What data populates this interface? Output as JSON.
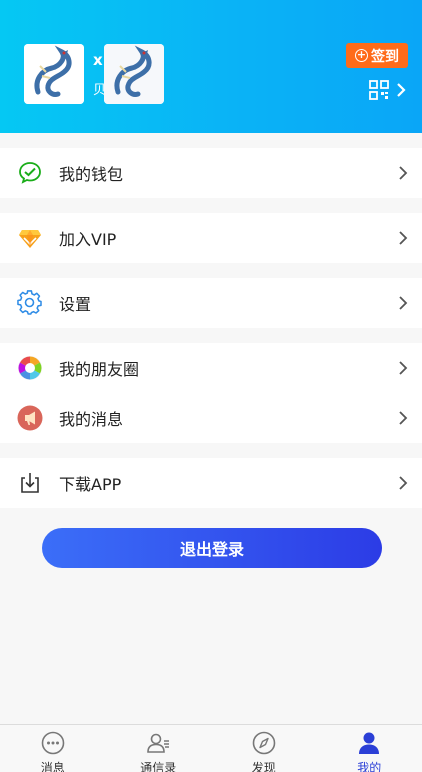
{
  "profile": {
    "name": "x",
    "subtitle": "贝",
    "checkin_label": "签到"
  },
  "menu": {
    "wallet": "我的钱包",
    "vip": "加入VIP",
    "settings": "设置",
    "moments": "我的朋友圈",
    "messages": "我的消息",
    "download": "下载APP"
  },
  "logout_label": "退出登录",
  "tabs": {
    "messages": "消息",
    "contacts": "通信录",
    "discover": "发现",
    "me": "我的"
  },
  "colors": {
    "header_start": "#05c8f3",
    "header_end": "#0aa6f7",
    "checkin": "#ff6b1a",
    "logout_start": "#3b6ef8",
    "logout_end": "#2c3ce6",
    "active_tab": "#2b3fd6"
  },
  "icons": {
    "wallet": "wechat-check-icon",
    "vip": "diamond-icon",
    "settings": "gear-icon",
    "moments": "camera-aperture-icon",
    "messages": "megaphone-icon",
    "download": "download-icon"
  }
}
